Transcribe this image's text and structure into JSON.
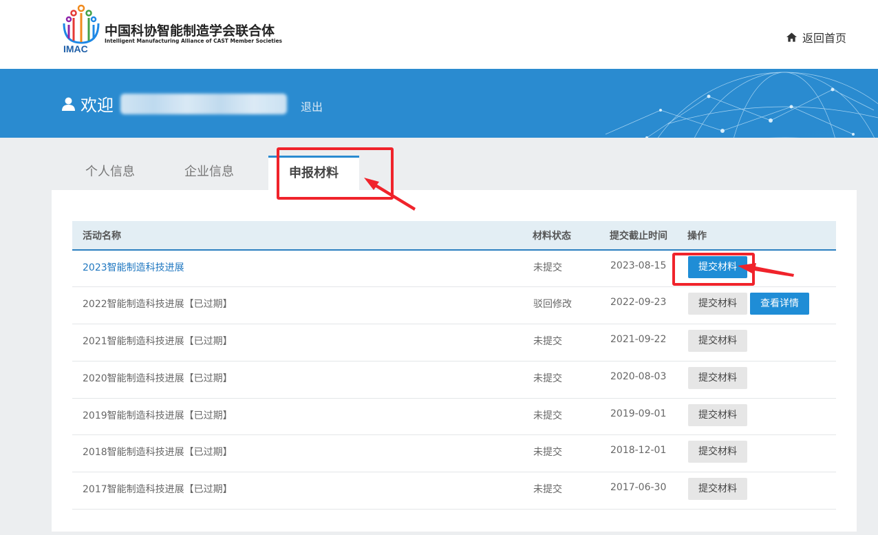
{
  "header": {
    "logo_cn": "中国科协智能制造学会联合体",
    "logo_en": "Intelligent Manufacturing Alliance of CAST Member Societies",
    "logo_abbr": "IMAC",
    "home_label": "返回首页",
    "home_icon": "home-icon"
  },
  "banner": {
    "welcome": "欢迎",
    "logout": "退出",
    "user_icon": "user-icon"
  },
  "tabs": [
    {
      "label": "个人信息"
    },
    {
      "label": "企业信息"
    },
    {
      "label": "申报材料",
      "active": true
    }
  ],
  "table": {
    "headers": {
      "name": "活动名称",
      "status": "材料状态",
      "deadline": "提交截止时间",
      "action": "操作"
    },
    "rows": [
      {
        "name": "2023智能制造科技进展",
        "status": "未提交",
        "deadline": "2023-08-15",
        "submit": "提交材料"
      },
      {
        "name": "2022智能制造科技进展【已过期】",
        "status": "驳回修改",
        "deadline": "2022-09-23",
        "submit": "提交材料",
        "detail": "查看详情"
      },
      {
        "name": "2021智能制造科技进展【已过期】",
        "status": "未提交",
        "deadline": "2021-09-22",
        "submit": "提交材料"
      },
      {
        "name": "2020智能制造科技进展【已过期】",
        "status": "未提交",
        "deadline": "2020-08-03",
        "submit": "提交材料"
      },
      {
        "name": "2019智能制造科技进展【已过期】",
        "status": "未提交",
        "deadline": "2019-09-01",
        "submit": "提交材料"
      },
      {
        "name": "2018智能制造科技进展【已过期】",
        "status": "未提交",
        "deadline": "2018-12-01",
        "submit": "提交材料"
      },
      {
        "name": "2017智能制造科技进展【已过期】",
        "status": "未提交",
        "deadline": "2017-06-30",
        "submit": "提交材料"
      }
    ]
  },
  "colors": {
    "brand_blue": "#2a8bd0",
    "link_blue": "#1f77c0",
    "button_blue": "#1f8dd6",
    "annotation_red": "#f0232b"
  }
}
